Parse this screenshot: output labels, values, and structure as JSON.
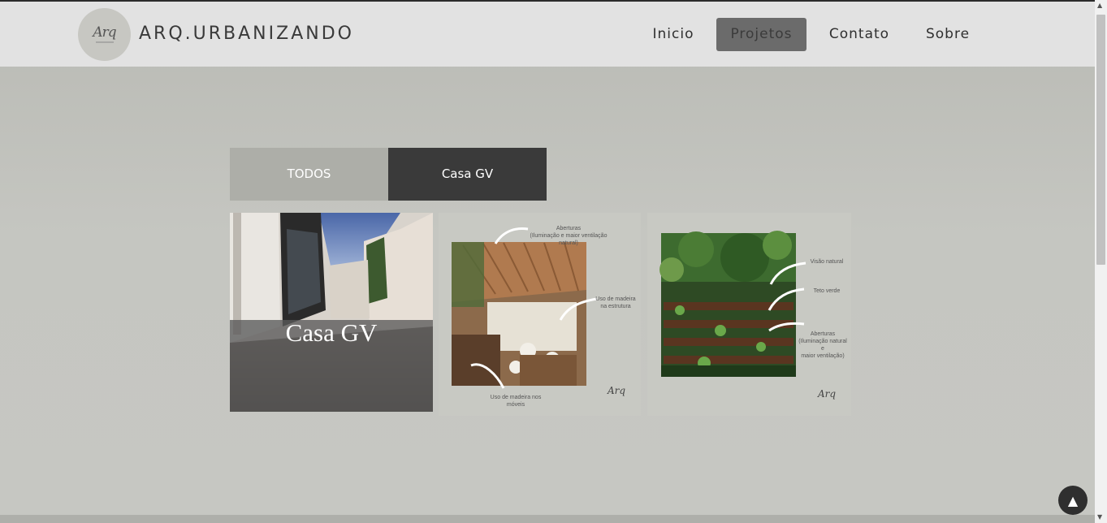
{
  "header": {
    "logo_text": "Arq",
    "brand": "ARQ.URBANIZANDO"
  },
  "nav": {
    "items": [
      {
        "label": "Inicio",
        "active": false
      },
      {
        "label": "Projetos",
        "active": true
      },
      {
        "label": "Contato",
        "active": false
      },
      {
        "label": "Sobre",
        "active": false
      }
    ]
  },
  "filters": {
    "todos": "TODOS",
    "casa_gv": "Casa GV"
  },
  "gallery": {
    "card1_title": "Casa GV",
    "card2": {
      "anno_top": "Aberturas\n(Iluminação e maior ventilação natural)",
      "anno_right": "Uso de madeira\nna estrutura",
      "anno_bottom": "Uso de madeira nos\nmóveis"
    },
    "card3": {
      "anno_1": "Visão natural",
      "anno_2": "Teto verde",
      "anno_3": "Aberturas\n(Iluminação natural e\nmaior ventilação)"
    }
  },
  "back_to_top_icon": "arrow-up-icon",
  "colors": {
    "header_bg": "#e2e2e2",
    "page_bg": "#c5c6c1",
    "active_nav": "#6b6b6b",
    "filter_active": "#3a3a3a",
    "filter_inactive": "#adaea8"
  }
}
